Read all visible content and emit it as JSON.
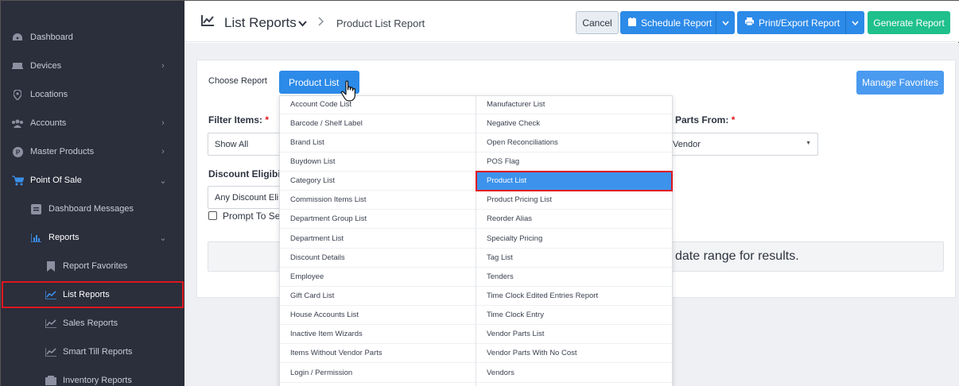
{
  "sidebar": {
    "items": [
      {
        "label": "Dashboard",
        "icon": "dashboard-icon",
        "chevron": "",
        "level": 0
      },
      {
        "label": "Devices",
        "icon": "devices-icon",
        "chevron": "›",
        "level": 0
      },
      {
        "label": "Locations",
        "icon": "location-pin-icon",
        "chevron": "",
        "level": 0
      },
      {
        "label": "Accounts",
        "icon": "users-icon",
        "chevron": "›",
        "level": 0
      },
      {
        "label": "Master Products",
        "icon": "master-products-icon",
        "chevron": "›",
        "level": 0
      },
      {
        "label": "Point Of Sale",
        "icon": "cart-icon",
        "chevron": "⌄",
        "level": 0
      },
      {
        "label": "Dashboard Messages",
        "icon": "message-icon",
        "chevron": "",
        "level": 1
      },
      {
        "label": "Reports",
        "icon": "bar-chart-icon",
        "chevron": "⌄",
        "level": 1
      },
      {
        "label": "Report Favorites",
        "icon": "bookmark-icon",
        "chevron": "",
        "level": 2
      },
      {
        "label": "List Reports",
        "icon": "line-chart-icon",
        "chevron": "",
        "level": 2
      },
      {
        "label": "Sales Reports",
        "icon": "line-chart-icon",
        "chevron": "",
        "level": 2
      },
      {
        "label": "Smart Till Reports",
        "icon": "line-chart-icon",
        "chevron": "",
        "level": 2
      },
      {
        "label": "Inventory Reports",
        "icon": "inventory-icon",
        "chevron": "",
        "level": 2
      }
    ]
  },
  "header": {
    "title": "List Reports",
    "breadcrumb": "Product List Report",
    "cancel": "Cancel",
    "schedule": "Schedule Report",
    "print_export": "Print/Export Report",
    "generate": "Generate Report"
  },
  "form": {
    "choose_report_label": "Choose Report",
    "report_button": "Product List",
    "manage_favorites": "Manage Favorites",
    "filter_items_label": "Filter Items:",
    "filter_items_value": "Show All",
    "parts_from_label": "Parts From:",
    "parts_from_value": "Vendor",
    "discount_label": "Discount Eligibi",
    "discount_value": "Any Discount Eli",
    "prompt_label": "Prompt To Se",
    "info_text": "date range for results."
  },
  "dropdown": {
    "left": [
      "Account Code List",
      "Barcode / Shelf Label",
      "Brand List",
      "Buydown List",
      "Category List",
      "Commission Items List",
      "Department Group List",
      "Department List",
      "Discount Details",
      "Employee",
      "Gift Card List",
      "House Accounts List",
      "Inactive Item Wizards",
      "Items Without Vendor Parts",
      "Login / Permission"
    ],
    "right": [
      "Manufacturer List",
      "Negative Check",
      "Open Reconciliations",
      "POS Flag",
      "Product List",
      "Product Pricing List",
      "Reorder Alias",
      "Specialty Pricing",
      "Tag List",
      "Tenders",
      "Time Clock Edited Entries Report",
      "Time Clock Entry",
      "Vendor Parts List",
      "Vendor Parts With No Cost",
      "Vendors"
    ],
    "selected": "Product List"
  },
  "colors": {
    "sidebar_bg": "#2b2e3b",
    "primary": "#2c8ae8",
    "success": "#1fc08c",
    "highlight": "#e0161e"
  }
}
